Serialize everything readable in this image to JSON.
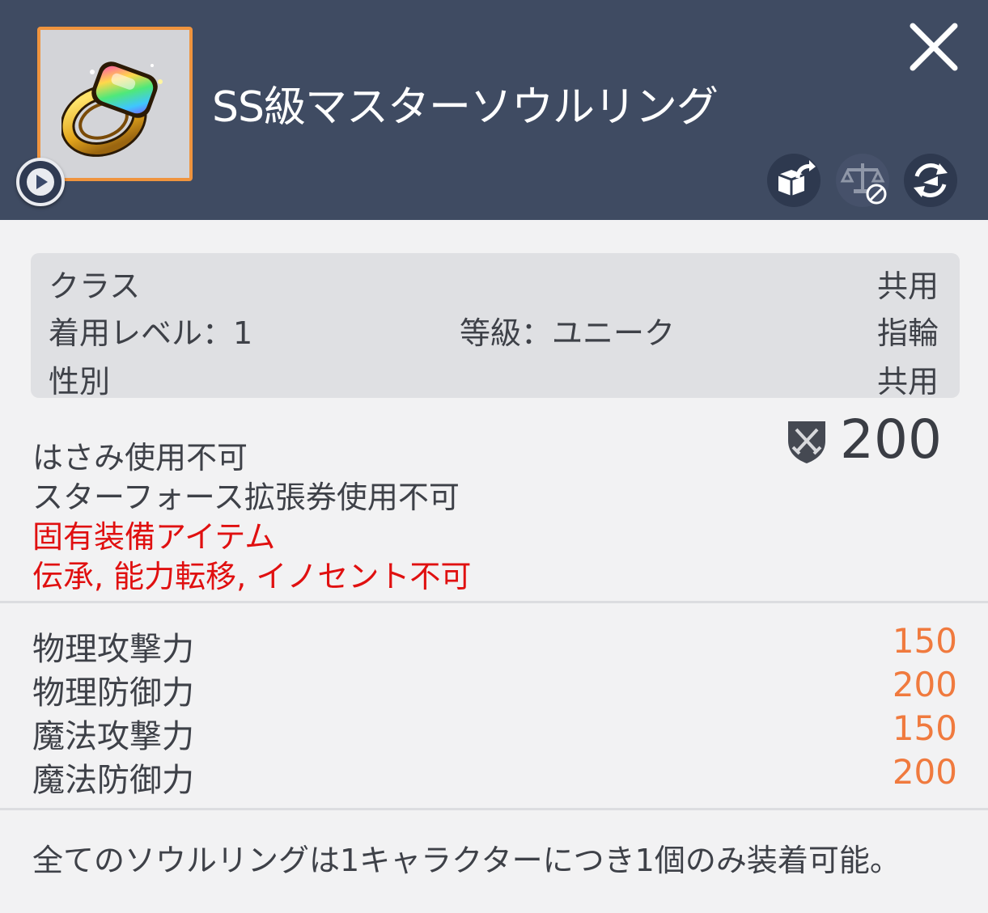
{
  "item": {
    "name": "SS級マスターソウルリング",
    "icon": "rainbow-gem-ring-icon"
  },
  "header_actions": {
    "close_icon": "close-icon",
    "play_icon": "play-icon",
    "action_icons": [
      "share-box-icon",
      "trade-disabled-icon",
      "transfer-icon"
    ]
  },
  "info": {
    "class_label": "クラス",
    "class_value": "共用",
    "level_label": "着用レベル：1",
    "grade_label": "等級：ユニーク",
    "type_value": "指輪",
    "gender_label": "性別",
    "gender_value": "共用"
  },
  "notes": {
    "line1": "はさみ使用不可",
    "line2": "スターフォース拡張券使用不可",
    "line3": "固有装備アイテム",
    "line4": "伝承, 能力転移, イノセント不可"
  },
  "combat_power": {
    "icon": "swords-shield-icon",
    "value": "200"
  },
  "stats": [
    {
      "name": "物理攻撃力",
      "value": "150"
    },
    {
      "name": "物理防御力",
      "value": "200"
    },
    {
      "name": "魔法攻撃力",
      "value": "150"
    },
    {
      "name": "魔法防御力",
      "value": "200"
    }
  ],
  "footer": {
    "text": "全てのソウルリングは1キャラクターにつき1個のみ装着可能。"
  },
  "colors": {
    "header_bg": "#3f4b62",
    "accent_orange": "#f0943e",
    "stat_value": "#f07a3e",
    "warning_red": "#e01010"
  }
}
